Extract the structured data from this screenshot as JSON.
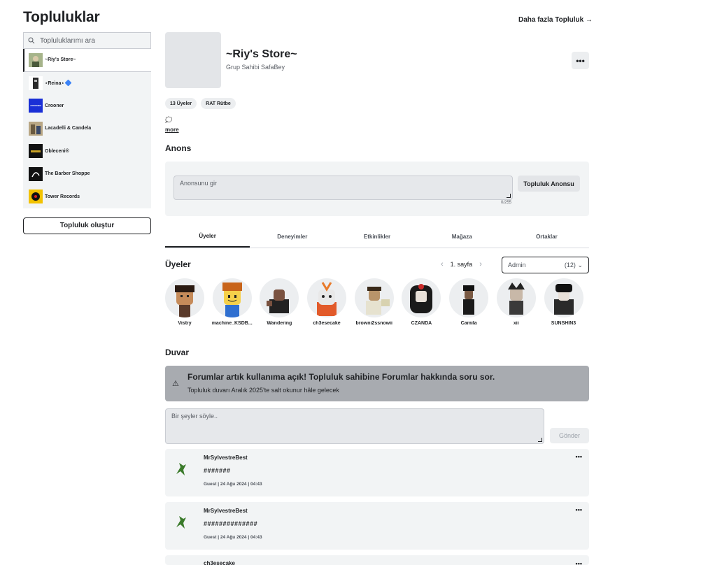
{
  "page": {
    "title": "Topluluklar",
    "more_link": "Daha fazla Topluluk →"
  },
  "sidebar": {
    "search_placeholder": "Topluluklarımı ara",
    "items": [
      {
        "label": "~Riy's Store~",
        "thumb": "#6b7a4a",
        "active": true
      },
      {
        "label": "⋆Reina⋆",
        "thumb": "#2a2a2a",
        "verified": true
      },
      {
        "label": "Crooner",
        "thumb": "#1a2fd6"
      },
      {
        "label": "Lacadelli & Candela",
        "thumb": "#8a7a5a"
      },
      {
        "label": "Obleceni®",
        "thumb": "#1a1a1a"
      },
      {
        "label": "The Barber Shoppe",
        "thumb": "#111111"
      },
      {
        "label": "Tower Records",
        "thumb": "#e8b800"
      }
    ],
    "create_label": "Topluluk oluştur"
  },
  "group": {
    "name": "~Riy's Store~",
    "owner": "Grup Sahibi SafaBey",
    "options_label": "•••",
    "chips": [
      "13 Üyeler",
      "RAT Rütbe"
    ],
    "description_preview": "💭",
    "more_label": "more"
  },
  "announcement": {
    "title": "Anons",
    "placeholder": "Anonsunu gir",
    "counter": "0/255",
    "button": "Topluluk Anonsu"
  },
  "tabs": [
    "Üyeler",
    "Deneyimler",
    "Etkinlikler",
    "Mağaza",
    "Ortaklar"
  ],
  "members": {
    "title": "Üyeler",
    "page_label": "1. sayfa",
    "role_name": "Admin",
    "role_count": "(12)",
    "list": [
      {
        "name": "Vistry"
      },
      {
        "name": "machine_KSDB..."
      },
      {
        "name": "Wandering"
      },
      {
        "name": "ch3esecake"
      },
      {
        "name": "browni2ssnowii"
      },
      {
        "name": "CZANDA"
      },
      {
        "name": "Camila"
      },
      {
        "name": "xii"
      },
      {
        "name": "SUNSHIN3"
      }
    ]
  },
  "wall": {
    "title": "Duvar",
    "banner_title": "Forumlar artık kullanıma açık! Topluluk sahibine Forumlar hakkında soru sor.",
    "banner_sub": "Topluluk duvarı Aralık 2025'te salt okunur hâle gelecek",
    "input_placeholder": "Bir şeyler söyle..",
    "send_label": "Gönder",
    "posts": [
      {
        "user": "MrSylvestreBest",
        "text": "#######",
        "meta": "Guest | 24 Ağu 2024 | 04:43"
      },
      {
        "user": "MrSylvestreBest",
        "text": "##############",
        "meta": "Guest | 24 Ağu 2024 | 04:43"
      },
      {
        "user": "ch3esecake",
        "text": "",
        "meta": ""
      }
    ]
  }
}
